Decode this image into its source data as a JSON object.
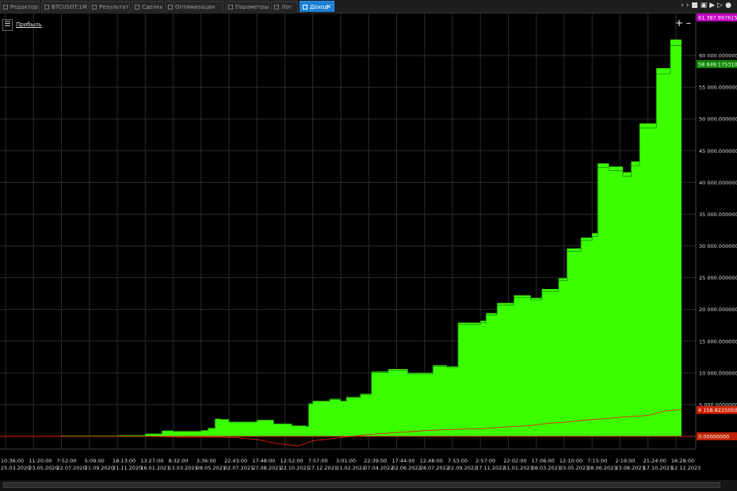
{
  "tabs": [
    {
      "label": "Редактор",
      "active": false
    },
    {
      "label": "BTCUSDT:1M",
      "active": false
    },
    {
      "label": "Результаты",
      "active": false
    },
    {
      "label": "Сделки",
      "active": false
    },
    {
      "label": "Оптимизация",
      "active": false
    },
    {
      "label": "Параметры",
      "active": false
    },
    {
      "label": "Лог",
      "active": false
    },
    {
      "label": "Доход",
      "active": true
    }
  ],
  "toolbar_icons": [
    "arrows-icon",
    "save-icon",
    "copy-icon",
    "play-icon",
    "stop-icon",
    "settings-icon"
  ],
  "legend": {
    "menu_icon": "list-icon",
    "label": "Прибыль"
  },
  "colors": {
    "profit_fill": "#3bff00",
    "profit_line": "#1a8a00",
    "drawdown_line": "#e02010",
    "zero_line": "#c82010",
    "max_tag": "#c000c0",
    "last_tag": "#0f8a00",
    "low_tag": "#d02000",
    "background": "#000000"
  },
  "chart_data": {
    "type": "area",
    "title": "",
    "xlabel": "",
    "ylabel": "",
    "ylim": [
      0,
      62000
    ],
    "grid": true,
    "x_ticks": [
      {
        "time": "10:36:00",
        "date": "25.03.2020"
      },
      {
        "time": "11:20:00",
        "date": "23.05.2020"
      },
      {
        "time": "7:52:00",
        "date": "22.07.2020"
      },
      {
        "time": "5:09:00",
        "date": "21.09.2020"
      },
      {
        "time": "18:13:00",
        "date": "21.11.2020"
      },
      {
        "time": "13:27:00",
        "date": "16.01.2021"
      },
      {
        "time": "8:32:00",
        "date": "13.03.2021"
      },
      {
        "time": "3:36:00",
        "date": "08.05.2021"
      },
      {
        "time": "22:43:00",
        "date": "02.07.2021"
      },
      {
        "time": "17:48:00",
        "date": "27.08.2021"
      },
      {
        "time": "12:52:00",
        "date": "22.10.2021"
      },
      {
        "time": "7:57:00",
        "date": "17.12.2021"
      },
      {
        "time": "3:01:00",
        "date": "11.02.2022"
      },
      {
        "time": "22:39:00",
        "date": "07.04.2022"
      },
      {
        "time": "17:44:00",
        "date": "02.06.2022"
      },
      {
        "time": "12:48:00",
        "date": "28.07.2022"
      },
      {
        "time": "7:53:00",
        "date": "22.09.2022"
      },
      {
        "time": "2:57:00",
        "date": "17.11.2022"
      },
      {
        "time": "22:02:00",
        "date": "11.01.2023"
      },
      {
        "time": "17:06:00",
        "date": "08.03.2023"
      },
      {
        "time": "12:10:00",
        "date": "03.05.2023"
      },
      {
        "time": "7:15:00",
        "date": "28.06.2023"
      },
      {
        "time": "2:19:00",
        "date": "23.08.2023"
      },
      {
        "time": "21:24:00",
        "date": "17.10.2023"
      },
      {
        "time": "16:28:00",
        "date": "12.12.2023"
      }
    ],
    "y_ticks": [
      {
        "value": 5000,
        "label": "5 000.00000000"
      },
      {
        "value": 10000,
        "label": "10 000.00000000"
      },
      {
        "value": 15000,
        "label": "15 000.00000000"
      },
      {
        "value": 20000,
        "label": "20 000.00000000"
      },
      {
        "value": 25000,
        "label": "25 000.00000000"
      },
      {
        "value": 30000,
        "label": "30 000.00000000"
      },
      {
        "value": 35000,
        "label": "35 000.00000000"
      },
      {
        "value": 40000,
        "label": "40 000.00000000"
      },
      {
        "value": 45000,
        "label": "45 000.00000000"
      },
      {
        "value": 50000,
        "label": "50 000.00000000"
      },
      {
        "value": 55000,
        "label": "55 000.00000000"
      },
      {
        "value": 60000,
        "label": "60 000.00000000"
      }
    ],
    "value_tags": [
      {
        "value": 62500,
        "label": "61 387.99761500",
        "color": "#c000c0"
      },
      {
        "value": 58649,
        "label": "58 649.17531000",
        "color": "#0f8a00"
      },
      {
        "value": 4150,
        "label": "4 158.82250500",
        "color": "#d02000"
      },
      {
        "value": 0,
        "label": "0.00000000",
        "color": "#c02000"
      }
    ],
    "series": [
      {
        "kind": "profit_area",
        "steps": [
          [
            0,
            0
          ],
          [
            2,
            100
          ],
          [
            4,
            150
          ],
          [
            5,
            400
          ],
          [
            5.6,
            900
          ],
          [
            6,
            800
          ],
          [
            7,
            950
          ],
          [
            7.25,
            1300
          ],
          [
            7.5,
            2800
          ],
          [
            7.7,
            2700
          ],
          [
            8,
            2300
          ],
          [
            9,
            2600
          ],
          [
            9.6,
            2000
          ],
          [
            10.25,
            1700
          ],
          [
            10.75,
            1600
          ],
          [
            10.85,
            5200
          ],
          [
            11,
            5600
          ],
          [
            11.6,
            5900
          ],
          [
            12,
            5600
          ],
          [
            12.2,
            6200
          ],
          [
            12.7,
            6700
          ],
          [
            13.1,
            10200
          ],
          [
            13.7,
            10600
          ],
          [
            14.4,
            10000
          ],
          [
            15.3,
            11200
          ],
          [
            15.8,
            11000
          ],
          [
            16.2,
            17900
          ],
          [
            17,
            18200
          ],
          [
            17.2,
            19400
          ],
          [
            17.6,
            21000
          ],
          [
            18.2,
            22200
          ],
          [
            18.8,
            21800
          ],
          [
            19.2,
            23200
          ],
          [
            19.8,
            24900
          ],
          [
            20.1,
            29600
          ],
          [
            20.6,
            31300
          ],
          [
            21,
            32000
          ],
          [
            21.2,
            43000
          ],
          [
            21.6,
            42500
          ],
          [
            22.1,
            41600
          ],
          [
            22.4,
            43300
          ],
          [
            22.7,
            49300
          ],
          [
            23.3,
            58000
          ],
          [
            23.8,
            62500
          ],
          [
            24.2,
            62500
          ]
        ]
      },
      {
        "kind": "drawdown_line",
        "points": [
          [
            0,
            0
          ],
          [
            5,
            0
          ],
          [
            6.5,
            -150
          ],
          [
            7.5,
            -100
          ],
          [
            8.3,
            -200
          ],
          [
            9,
            -500
          ],
          [
            9.8,
            -1200
          ],
          [
            10.5,
            -1500
          ],
          [
            11,
            -700
          ],
          [
            12,
            -200
          ],
          [
            13,
            300
          ],
          [
            14,
            600
          ],
          [
            15,
            900
          ],
          [
            16,
            1100
          ],
          [
            17,
            1200
          ],
          [
            18,
            1500
          ],
          [
            18.8,
            1700
          ],
          [
            19.5,
            2100
          ],
          [
            20,
            2200
          ],
          [
            20.8,
            2600
          ],
          [
            21.5,
            2800
          ],
          [
            22,
            3000
          ],
          [
            23,
            3300
          ],
          [
            23.6,
            4000
          ],
          [
            24.2,
            4200
          ]
        ]
      }
    ]
  }
}
